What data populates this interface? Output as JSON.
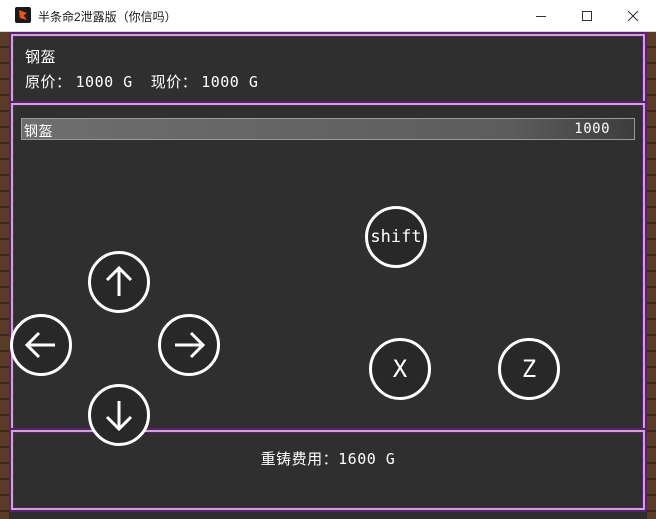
{
  "window": {
    "title": "半条命2泄露版（你信吗）"
  },
  "shop": {
    "item_name": "钢盔",
    "original_price_label": "原价：",
    "original_price": "1000 G",
    "current_price_label": "现价：",
    "current_price": "1000 G"
  },
  "item_list": [
    {
      "name": "钢盔",
      "price": "1000"
    }
  ],
  "recast": {
    "label": "重铸费用：",
    "cost": "1600 G"
  },
  "controls": {
    "shift_label": "shift",
    "x_label": "X",
    "z_label": "Z",
    "up_icon": "arrow-up-icon",
    "down_icon": "arrow-down-icon",
    "left_icon": "arrow-left-icon",
    "right_icon": "arrow-right-icon"
  },
  "colors": {
    "panel_border": "#5a1e72",
    "panel_bg": "#2f2f2f",
    "text": "#ffffff"
  }
}
